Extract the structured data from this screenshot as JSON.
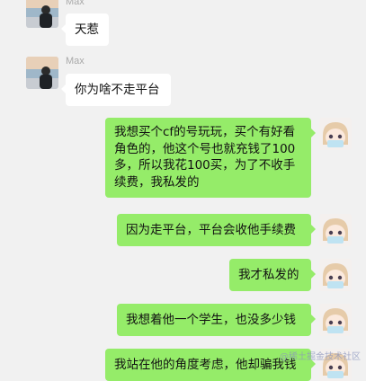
{
  "contact": {
    "name": "Max"
  },
  "messages": [
    {
      "sender": "contact",
      "text": "天惹"
    },
    {
      "sender": "contact",
      "text": "你为啥不走平台"
    },
    {
      "sender": "me",
      "text": "我想买个cf的号玩玩，买个有好看角色的，他这个号也就充钱了100多，所以我花100买，为了不收手续费，我私发的"
    },
    {
      "sender": "me",
      "text": "因为走平台，平台会收他手续费"
    },
    {
      "sender": "me",
      "text": "我才私发的"
    },
    {
      "sender": "me",
      "text": "我想着他一个学生，也没多少钱"
    },
    {
      "sender": "me",
      "text": "我站在他的角度考虑，他却骗我钱"
    }
  ],
  "watermark": "@稀土掘金技术社区",
  "colors": {
    "background": "#f1f1f1",
    "incoming": "#ffffff",
    "outgoing": "#95ec69"
  }
}
